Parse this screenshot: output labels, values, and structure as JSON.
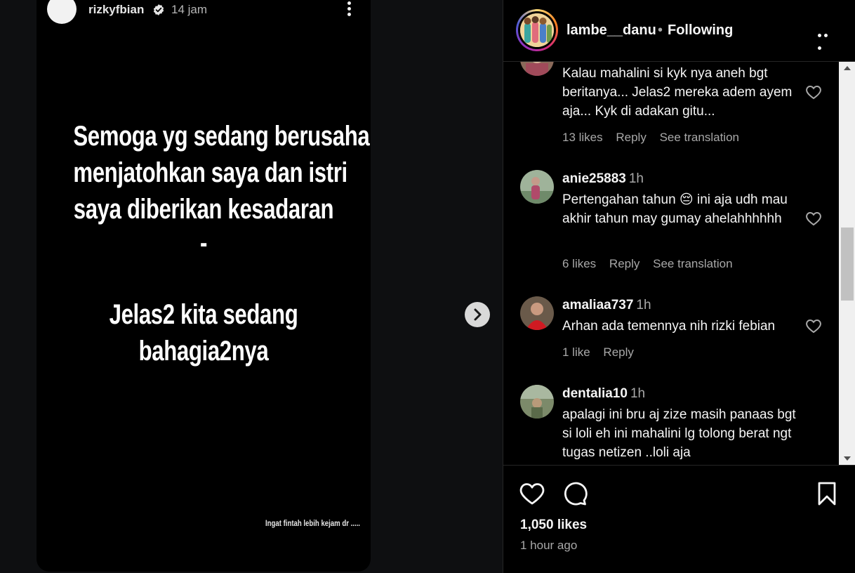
{
  "story": {
    "username": "rizkyfbian",
    "time": "14 jam",
    "lines": [
      "Semoga yg sedang berusaha",
      "menjatohkan saya dan istri",
      "saya diberikan kesadaran",
      "-",
      "Jelas2 kita sedang",
      "bahagia2nya"
    ],
    "footnote": "Ingat fintah lebih kejam dr ....."
  },
  "post": {
    "author": "lambe__danu",
    "separator": "•",
    "follow_status": "Following"
  },
  "comments": [
    {
      "text": "Kalau mahalini si kyk nya aneh bgt beritanya... Jelas2 mereka adem ayem aja... Kyk di adakan gitu...",
      "likes": "13 likes",
      "reply": "Reply",
      "translate": "See translation"
    },
    {
      "username": "anie25883",
      "time": "1h",
      "text": "Pertengahan tahun 😔 ini aja udh mau akhir tahun may gumay ahelahhhhhh",
      "likes": "6 likes",
      "reply": "Reply",
      "translate": "See translation"
    },
    {
      "username": "amaliaa737",
      "time": "1h",
      "text": "Arhan ada temennya nih rizki febian",
      "likes": "1 like",
      "reply": "Reply"
    },
    {
      "username": "dentalia10",
      "time": "1h",
      "text": "apalagi ini bru aj zize masih panaas bgt si loli eh ini mahalini lg tolong berat ngt tugas netizen ..loli aja"
    }
  ],
  "footer": {
    "likes": "1,050 likes",
    "time": "1 hour ago"
  },
  "icons": {
    "verified": "verified-badge-icon",
    "next": "chevron-right-icon",
    "like": "heart-icon",
    "comment": "comment-bubble-icon",
    "save": "bookmark-icon"
  }
}
